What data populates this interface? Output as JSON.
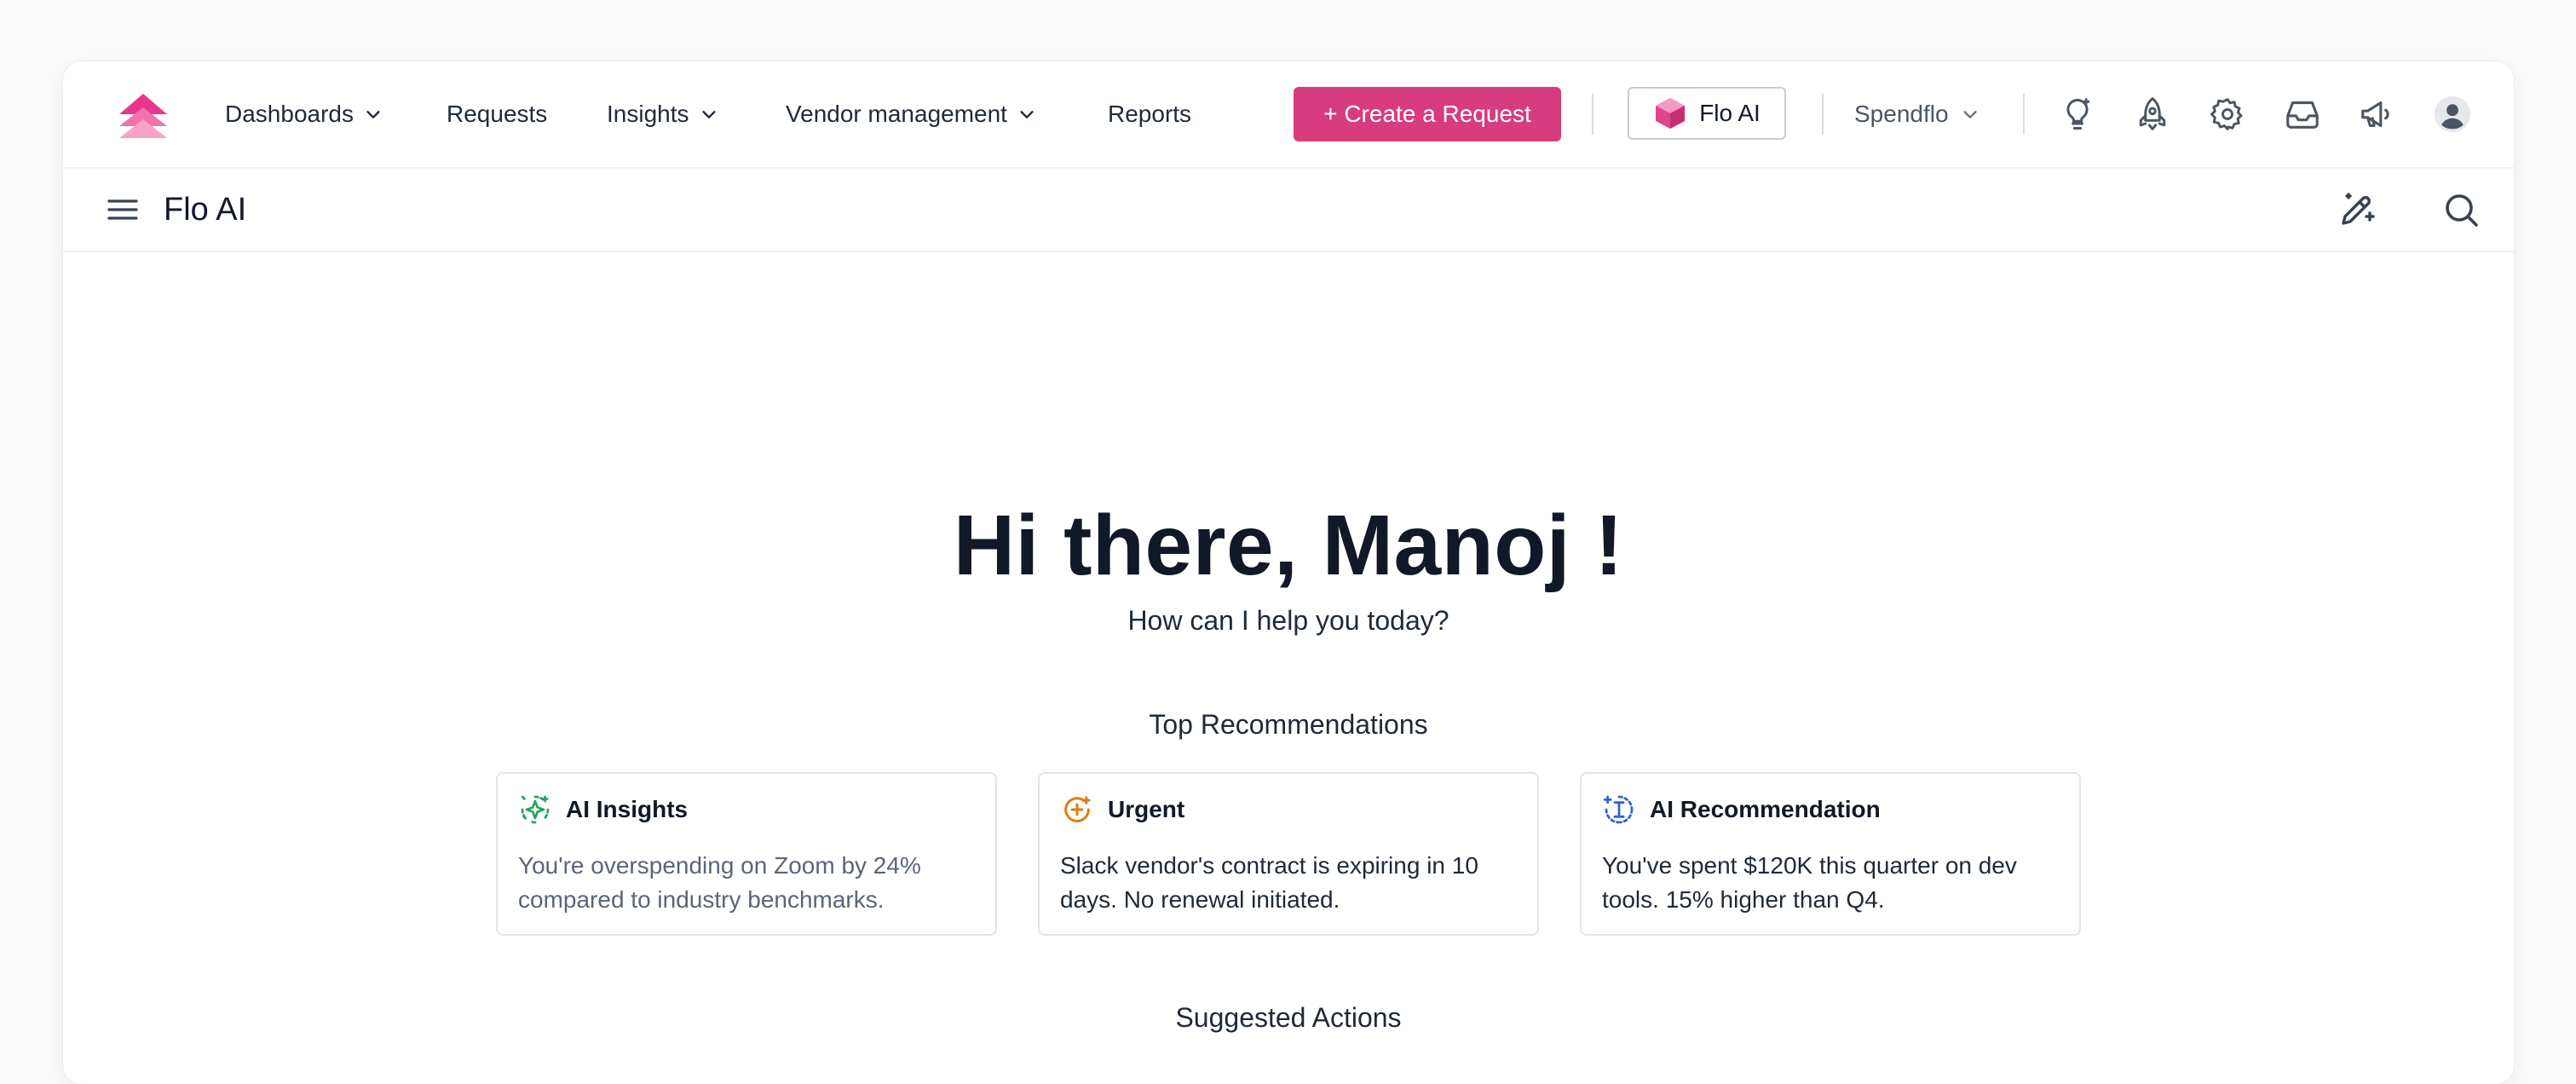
{
  "nav": {
    "items": [
      {
        "label": "Dashboards",
        "has_dropdown": true
      },
      {
        "label": "Requests",
        "has_dropdown": false
      },
      {
        "label": "Insights",
        "has_dropdown": true
      },
      {
        "label": "Vendor management",
        "has_dropdown": true
      },
      {
        "label": "Reports",
        "has_dropdown": false
      }
    ],
    "create_button": "+ Create a Request",
    "flo_button": "Flo AI",
    "org_select": "Spendflo",
    "icons": [
      "lightbulb-icon",
      "rocket-icon",
      "gear-icon",
      "inbox-icon",
      "megaphone-icon",
      "user-avatar-icon"
    ]
  },
  "subheader": {
    "title": "Flo AI",
    "icons": [
      "menu-icon",
      "edit-pen-icon",
      "search-icon"
    ]
  },
  "main": {
    "greeting": "Hi there, Manoj !",
    "subtitle": "How can I help you today?",
    "recommendations_title": "Top Recommendations",
    "cards": [
      {
        "title": "AI Insights",
        "icon": "sparkle-icon",
        "icon_color": "#22a45d",
        "body": "You're overspending on Zoom by 24% compared to industry benchmarks."
      },
      {
        "title": "Urgent",
        "icon": "urgent-plus-icon",
        "icon_color": "#e07b12",
        "body": "Slack vendor's contract is expiring in 10 days. No renewal initiated."
      },
      {
        "title": "AI Recommendation",
        "icon": "ai-text-icon",
        "icon_color": "#2e63d9",
        "body": "You've spent $120K this quarter on dev tools. 15% higher than Q4."
      }
    ],
    "suggested_title": "Suggested Actions"
  },
  "colors": {
    "brand": "#d63c7e",
    "text": "#111827",
    "border": "#e3e5e9"
  }
}
